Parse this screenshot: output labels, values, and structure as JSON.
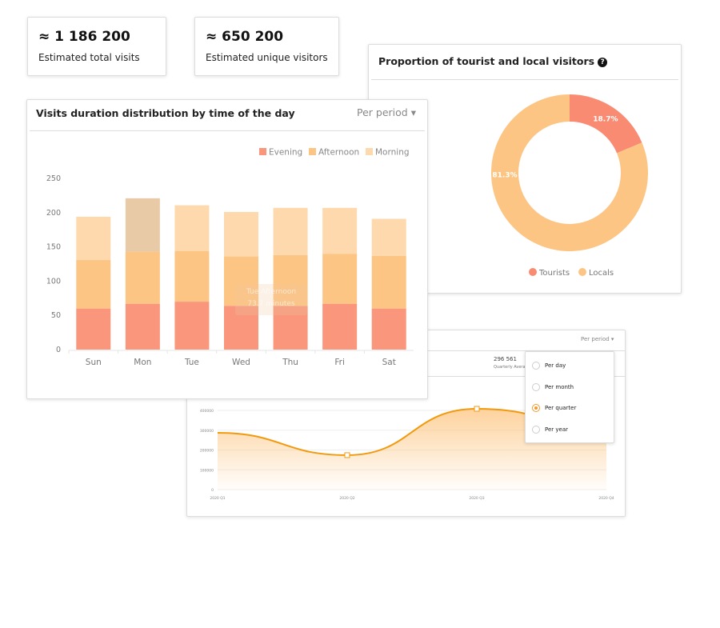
{
  "stats": [
    {
      "value": "≈ 1 186 200",
      "label": "Estimated total visits"
    },
    {
      "value": "≈ 650 200",
      "label": "Estimated unique visitors"
    }
  ],
  "donut_card": {
    "title": "Proportion of tourist and local visitors",
    "help_icon": "question-circle-icon"
  },
  "bar_card": {
    "title": "Visits duration distribution by time of the day",
    "period_label": "Per period",
    "tooltip": {
      "title": "Tue Afternoon",
      "value": "73.7 minutes"
    }
  },
  "line_card": {
    "period_label": "Per period",
    "summary_value": "296 561",
    "summary_label": "Quarterly Average",
    "dropdown": {
      "options": [
        {
          "label": "Per day",
          "selected": false
        },
        {
          "label": "Per month",
          "selected": false
        },
        {
          "label": "Per quarter",
          "selected": true
        },
        {
          "label": "Per year",
          "selected": false
        }
      ]
    }
  },
  "colors": {
    "evening": "#f9967c",
    "afternoon": "#fdc583",
    "morning": "#fdd9ad",
    "tourists": "#f98b72",
    "locals": "#fdc583",
    "line": "#f29a0e"
  },
  "chart_data": [
    {
      "type": "bar",
      "stacked": true,
      "categories": [
        "Sun",
        "Mon",
        "Tue",
        "Wed",
        "Thu",
        "Fri",
        "Sat"
      ],
      "series": [
        {
          "name": "Evening",
          "values": [
            60,
            67,
            70,
            64,
            64,
            67,
            60
          ]
        },
        {
          "name": "Afternoon",
          "values": [
            71,
            76,
            73.7,
            72,
            74,
            73,
            77
          ]
        },
        {
          "name": "Morning",
          "values": [
            63,
            78,
            67,
            65,
            69,
            67,
            54
          ]
        }
      ],
      "yticks": [
        0,
        50,
        100,
        150,
        200,
        250
      ],
      "ylim": [
        0,
        250
      ],
      "legend": "top-right",
      "grid": false
    },
    {
      "type": "pie",
      "donut": true,
      "series": [
        {
          "name": "Tourists",
          "value": 18.7,
          "label": "18.7%"
        },
        {
          "name": "Locals",
          "value": 81.3,
          "label": "81.3%"
        }
      ],
      "legend": "bottom"
    },
    {
      "type": "area",
      "categories": [
        "2020 Q1",
        "2020 Q2",
        "2020 Q3",
        "2020 Q4"
      ],
      "values": [
        287000,
        174000,
        408000,
        317000
      ],
      "yticks": [
        0,
        100000,
        200000,
        300000,
        400000
      ],
      "ytick_labels": [
        "0",
        "100000",
        "200000",
        "300000",
        "400000"
      ],
      "ylim": [
        0,
        400000
      ],
      "grid": true
    }
  ]
}
